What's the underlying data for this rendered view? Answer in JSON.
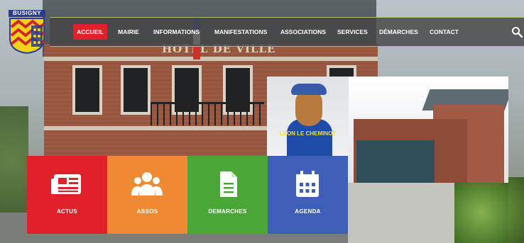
{
  "logo": {
    "name": "BUSIGNY"
  },
  "nav": {
    "items": [
      {
        "label": "ACCUEIL",
        "active": true
      },
      {
        "label": "MAIRIE",
        "active": false
      },
      {
        "label": "INFORMATIONS",
        "active": false
      },
      {
        "label": "MANIFESTATIONS",
        "active": false
      },
      {
        "label": "ASSOCIATIONS",
        "active": false
      },
      {
        "label": "SERVICES",
        "active": false
      },
      {
        "label": "DÉMARCHES",
        "active": false
      },
      {
        "label": "CONTACT",
        "active": false
      }
    ],
    "search_icon": "search-icon",
    "active_color": "#e2202a"
  },
  "hero": {
    "building_sign": "HOTEL DE VILLE",
    "leon_caption": "LÉON LE CHEMINOT"
  },
  "tiles": [
    {
      "label": "ACTUS",
      "icon": "newspaper-icon",
      "color": "#e2202a"
    },
    {
      "label": "ASSOS",
      "icon": "users-icon",
      "color": "#ef8a33"
    },
    {
      "label": "DEMARCHES",
      "icon": "document-icon",
      "color": "#4aa637"
    },
    {
      "label": "AGENDA",
      "icon": "calendar-icon",
      "color": "#3d5fb8"
    }
  ]
}
